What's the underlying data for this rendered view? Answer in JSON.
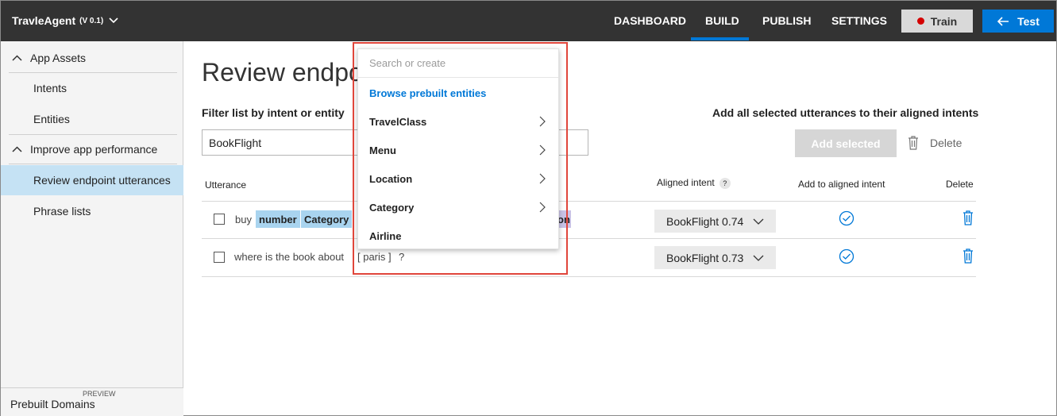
{
  "header": {
    "app_name": "TravleAgent",
    "version": "(V 0.1)",
    "nav": [
      "DASHBOARD",
      "BUILD",
      "PUBLISH",
      "SETTINGS"
    ],
    "active_nav": "BUILD",
    "train_label": "Train",
    "test_label": "Test"
  },
  "sidebar": {
    "app_assets": "App Assets",
    "intents": "Intents",
    "entities": "Entities",
    "improve": "Improve app performance",
    "review": "Review endpoint utterances",
    "phrase_lists": "Phrase lists",
    "preview": "PREVIEW",
    "prebuilt_domains": "Prebuilt Domains"
  },
  "main": {
    "title": "Review endpo",
    "filter_label": "Filter list by intent or entity",
    "filter_value": "BookFlight",
    "add_all_label": "Add all selected utterances to their aligned intents",
    "add_selected": "Add selected",
    "delete": "Delete",
    "columns": {
      "utterance": "Utterance",
      "aligned_intent": "Aligned intent",
      "help": "?",
      "add_to_aligned": "Add to aligned intent",
      "delete": "Delete"
    },
    "rows": [
      {
        "prefix": "buy",
        "entities": [
          "number",
          "Category"
        ],
        "trailing_fragment": "on",
        "intent": "BookFlight 0.74"
      },
      {
        "text": "where is the book about",
        "bracket": "[ paris ]",
        "suffix": "?",
        "intent": "BookFlight 0.73"
      }
    ]
  },
  "dropdown": {
    "search_placeholder": "Search or create",
    "browse": "Browse prebuilt entities",
    "items": [
      {
        "label": "TravelClass",
        "has_submenu": true
      },
      {
        "label": "Menu",
        "has_submenu": true
      },
      {
        "label": "Location",
        "has_submenu": true
      },
      {
        "label": "Category",
        "has_submenu": true
      },
      {
        "label": "Airline",
        "has_submenu": false
      }
    ]
  },
  "colors": {
    "topbar": "#333333",
    "accent": "#0078d7",
    "entity_chip": "#a9d4ef",
    "sidebar_active": "#c5e2f4",
    "highlight": "#e0463b",
    "train_dot": "#d40000"
  }
}
